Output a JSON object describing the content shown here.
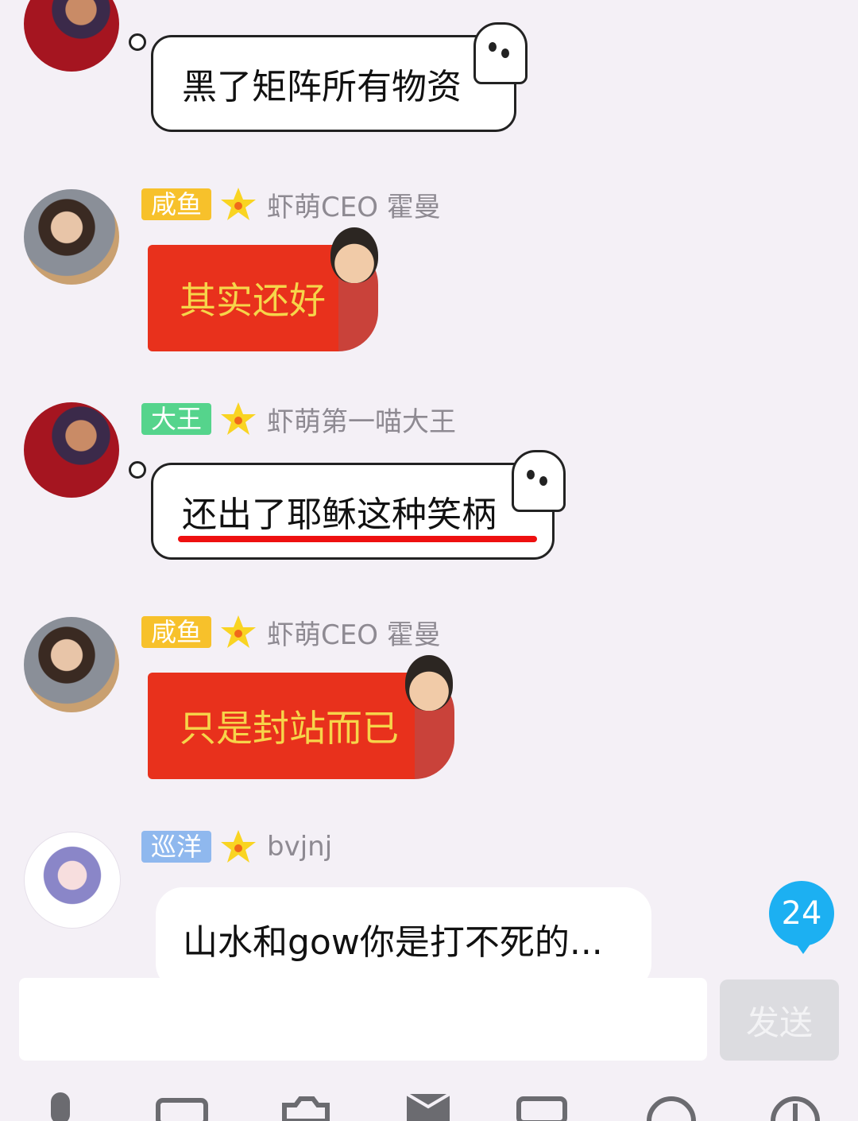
{
  "messages": [
    {
      "tag": "",
      "sender": "",
      "text": "黑了矩阵所有物资"
    },
    {
      "tag": "咸鱼",
      "sender": "虾萌CEO 霍曼",
      "text": "其实还好"
    },
    {
      "tag": "大王",
      "sender": "虾萌第一喵大王",
      "text": "还出了耶稣这种笑柄"
    },
    {
      "tag": "咸鱼",
      "sender": "虾萌CEO 霍曼",
      "text": "只是封站而已"
    },
    {
      "tag": "巡洋",
      "sender": "bvjnj",
      "text": "山水和gow你是打不死的..."
    }
  ],
  "unread_badge": "24",
  "composer": {
    "placeholder": "",
    "send_label": "发送"
  },
  "toolbar_icons": [
    "mic-icon",
    "image-icon",
    "camera-icon",
    "redpacket-icon",
    "gif-icon",
    "emoji-icon",
    "more-icon"
  ],
  "colors": {
    "background": "#f4f0f6",
    "tag_yellow": "#f7c12b",
    "tag_green": "#55d48c",
    "tag_blue": "#8fb8ee",
    "red_bubble": "#e8311c",
    "badge": "#1cb0f2"
  }
}
